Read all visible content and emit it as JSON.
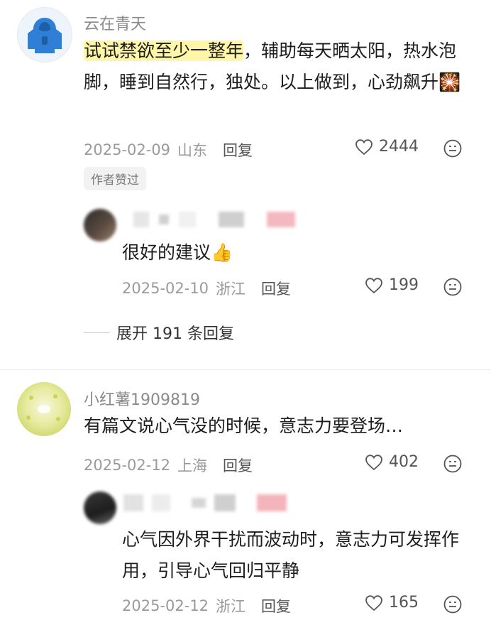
{
  "comments": [
    {
      "username": "云在青天",
      "text_highlight": "试试禁欲至少一整年",
      "text_rest": "，辅助每天晒太阳，热水泡脚，睡到自然行，独处。以上做到，心劲飙升",
      "emoji": "🎇",
      "date": "2025-02-09",
      "location": "山东",
      "reply_label": "回复",
      "likes": "2444",
      "badge": "作者赞过",
      "replies": [
        {
          "text": "很好的建议",
          "emoji": "👍",
          "date": "2025-02-10",
          "location": "浙江",
          "reply_label": "回复",
          "likes": "199"
        }
      ],
      "expand_label": "展开 191 条回复"
    },
    {
      "username": "小红薯1909819",
      "text": "有篇文说心气没的时候，意志力要登场…",
      "date": "2025-02-12",
      "location": "上海",
      "reply_label": "回复",
      "likes": "402",
      "replies": [
        {
          "text": "心气因外界干扰而波动时，意志力可发挥作用，引导心气回归平静",
          "date": "2025-02-12",
          "location": "浙江",
          "reply_label": "回复",
          "likes": "165"
        }
      ]
    }
  ],
  "icons": {
    "heart": "heart-icon",
    "emoji_reaction": "emoji-reaction-icon"
  },
  "colors": {
    "highlight": "#fff6a8",
    "meta": "#9a9a9a"
  }
}
